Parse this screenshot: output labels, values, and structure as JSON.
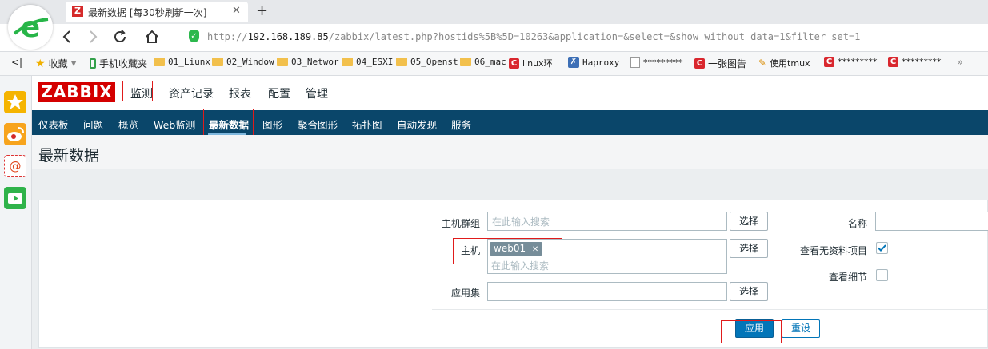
{
  "browser": {
    "tab_title": "最新数据 [每30秒刷新一次]",
    "tab_icon_letter": "Z",
    "new_tab": "+",
    "url_prefix": "http://",
    "url_host": "192.168.189.85",
    "url_path": "/zabbix/latest.php?hostids%5B%5D=10263&application=&select=&show_without_data=1&filter_set=1",
    "bookmarks": [
      {
        "label": "收藏",
        "icon": "star-icon"
      },
      {
        "label": "手机收藏夹",
        "icon": "phone-icon"
      },
      {
        "label": "01_Liunx",
        "icon": "folder-icon"
      },
      {
        "label": "02_Window",
        "icon": "folder-icon"
      },
      {
        "label": "03_Networ",
        "icon": "folder-icon"
      },
      {
        "label": "04_ESXI",
        "icon": "folder-icon"
      },
      {
        "label": "05_Openst",
        "icon": "folder-icon"
      },
      {
        "label": "06_mac",
        "icon": "folder-icon"
      },
      {
        "label": "linux环",
        "icon": "c-icon"
      },
      {
        "label": "Haproxy",
        "icon": "x-icon"
      },
      {
        "label": "*********",
        "icon": "page-icon"
      },
      {
        "label": "一张图告",
        "icon": "c-icon"
      },
      {
        "label": "使用tmux",
        "icon": "pen-icon"
      },
      {
        "label": "*********",
        "icon": "c-icon"
      },
      {
        "label": "*********",
        "icon": "c-icon"
      }
    ],
    "bookmarks_more": "»",
    "bookmark_toggle": "<|"
  },
  "zabbix": {
    "logo": "ZABBIX",
    "top_menu": [
      "监测",
      "资产记录",
      "报表",
      "配置",
      "管理"
    ],
    "sub_menu": [
      "仪表板",
      "问题",
      "概览",
      "Web监测",
      "最新数据",
      "图形",
      "聚合图形",
      "拓扑图",
      "自动发现",
      "服务"
    ],
    "page_title": "最新数据",
    "filter": {
      "host_group_label": "主机群组",
      "host_group_placeholder": "在此输入搜索",
      "host_label": "主机",
      "host_chip": "web01",
      "host_chip_remove": "✕",
      "host_placeholder": "在此输入搜索",
      "application_label": "应用集",
      "select_button": "选择",
      "name_label": "名称",
      "show_without_data_label": "查看无资料项目",
      "show_without_data_checked": true,
      "show_details_label": "查看细节",
      "show_details_checked": false,
      "apply_button": "应用",
      "reset_button": "重设"
    }
  },
  "colors": {
    "zabbix_red": "#d40000",
    "submenu_bg": "#0a466a",
    "apply_blue": "#0275b8",
    "highlight_red": "#e01b1b"
  }
}
